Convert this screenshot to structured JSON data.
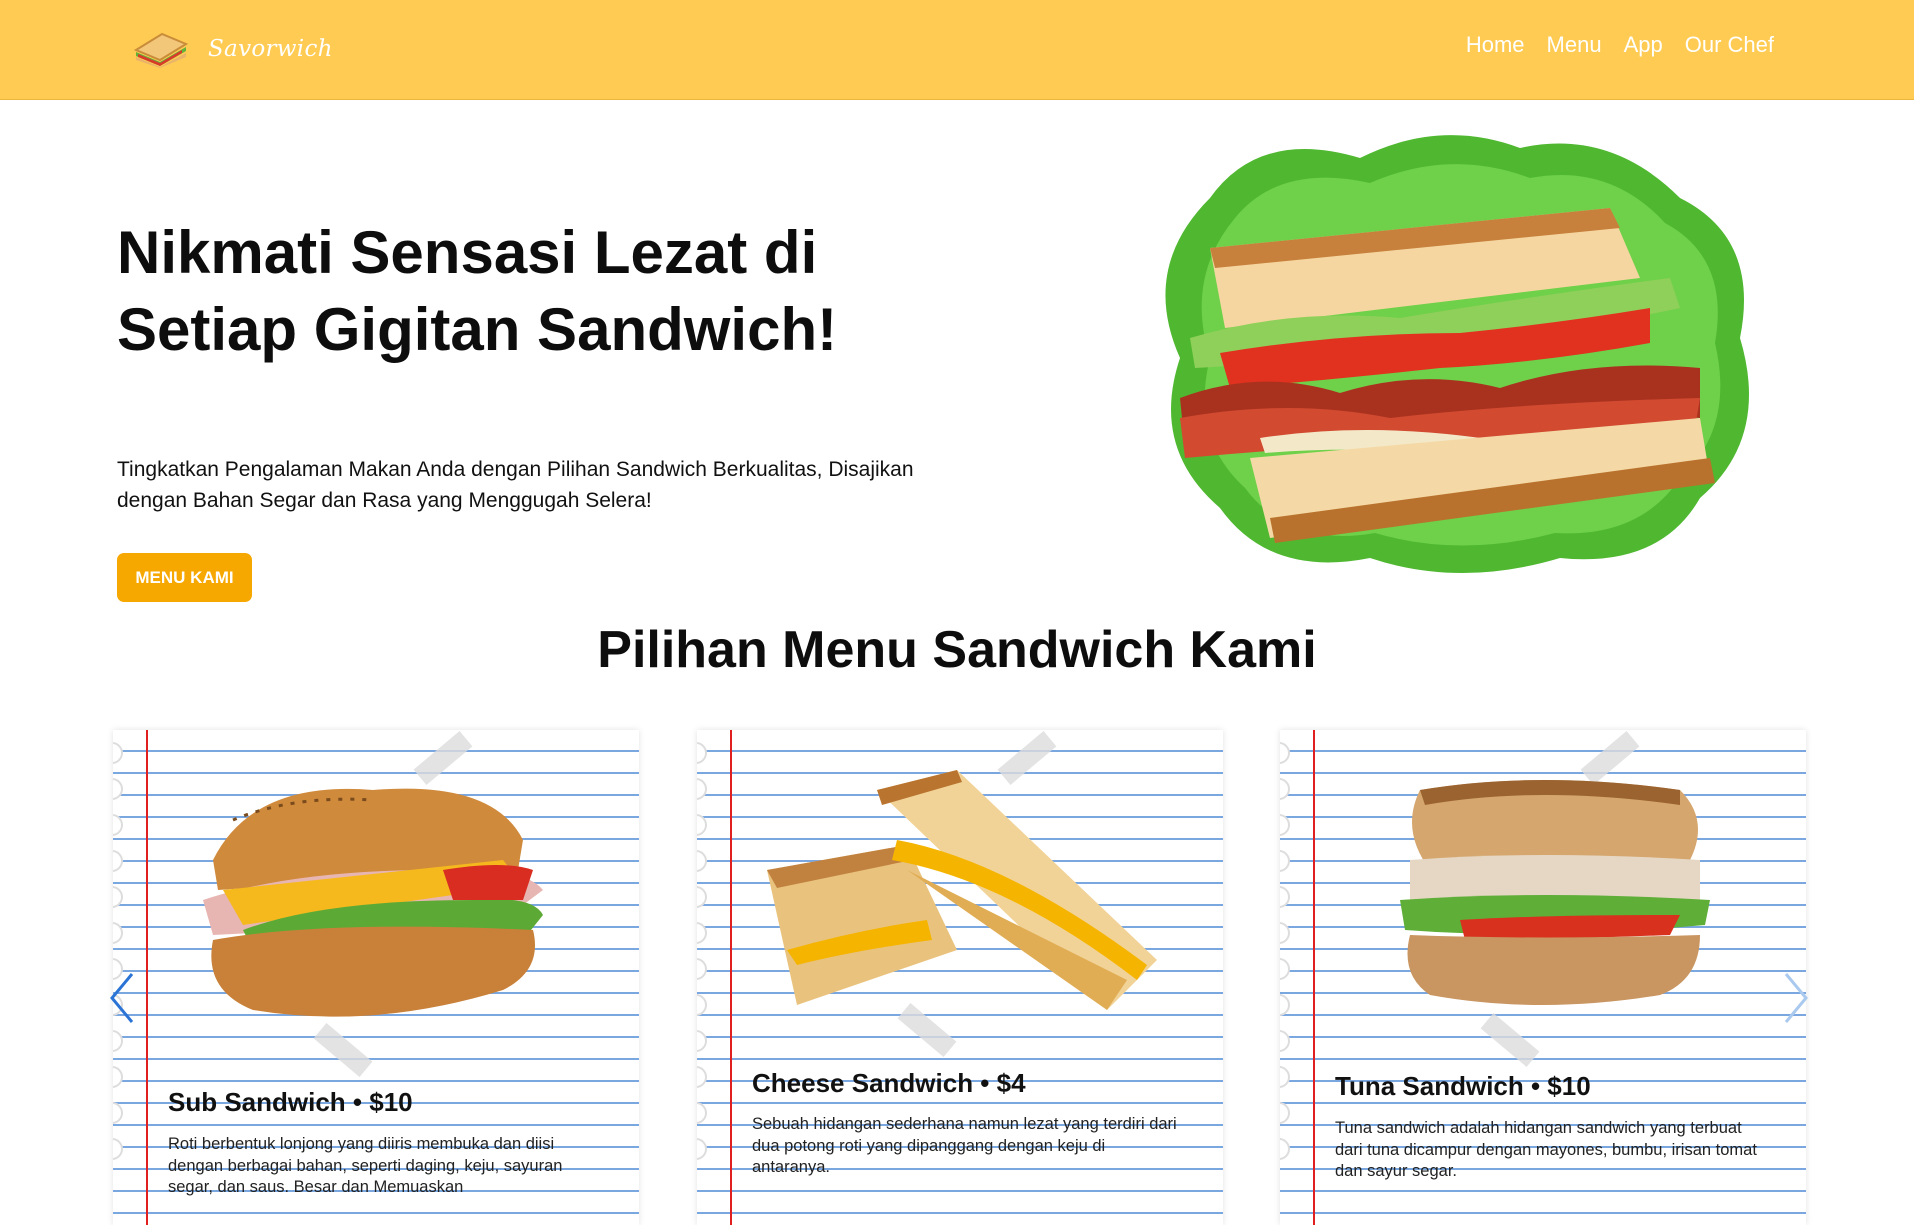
{
  "brand": {
    "name": "Savorwich",
    "logo_icon": "sandwich-logo-icon"
  },
  "nav": {
    "links": [
      "Home",
      "Menu",
      "App",
      "Our Chef"
    ]
  },
  "hero": {
    "title_line1": "Nikmati Sensasi Lezat di",
    "title_line2": "Setiap Gigitan Sandwich!",
    "description": "Tingkatkan Pengalaman Makan Anda dengan Pilihan Sandwich Berkualitas, Disajikan dengan Bahan Segar dan Rasa yang Menggugah Selera!",
    "button_label": "MENU KAMI"
  },
  "menu": {
    "title": "Pilihan Menu Sandwich Kami",
    "cards": [
      {
        "title": "Sub Sandwich • $10",
        "description": "Roti berbentuk lonjong yang diiris membuka dan diisi dengan berbagai bahan, seperti daging, keju, sayuran segar, dan saus. Besar dan Memuaskan"
      },
      {
        "title": "Cheese Sandwich • $4",
        "description": "Sebuah hidangan sederhana namun lezat yang terdiri dari dua potong roti yang dipanggang dengan keju di antaranya."
      },
      {
        "title": "Tuna Sandwich • $10",
        "description": "Tuna sandwich adalah hidangan sandwich yang terbuat dari tuna dicampur dengan mayones, bumbu, irisan tomat dan sayur segar."
      }
    ]
  },
  "colors": {
    "navbar": "#ffcb52",
    "button": "#f7a800",
    "arrow_left": "#2b74d6",
    "arrow_right": "#a9c9ef"
  }
}
